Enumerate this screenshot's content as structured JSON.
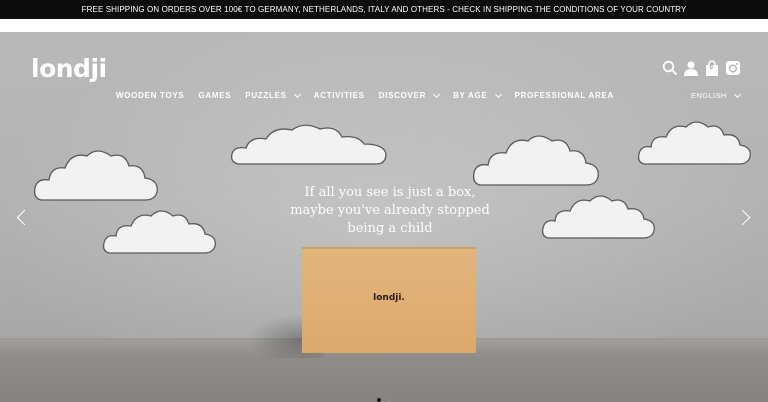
{
  "announcement": {
    "text": "FREE SHIPPING ON ORDERS OVER 100€ TO GERMANY, NETHERLANDS, ITALY AND OTHERS - CHECK IN SHIPPING THE CONDITIONS OF YOUR COUNTRY"
  },
  "header": {
    "logo": "londji",
    "nav": [
      {
        "label": "WOODEN TOYS",
        "dropdown": false
      },
      {
        "label": "GAMES",
        "dropdown": false
      },
      {
        "label": "PUZZLES",
        "dropdown": true
      },
      {
        "label": "ACTIVITIES",
        "dropdown": false
      },
      {
        "label": "DISCOVER",
        "dropdown": true
      },
      {
        "label": "BY AGE",
        "dropdown": true
      },
      {
        "label": "PROFESSIONAL AREA",
        "dropdown": false
      }
    ],
    "language": "ENGLISH",
    "icons": [
      "search-icon",
      "user-icon",
      "cart-icon",
      "instagram-icon"
    ],
    "cart_count": "0"
  },
  "hero": {
    "tagline_lines": [
      "If all you see is just a box,",
      "maybe you've already stopped",
      "being a child"
    ],
    "box_logo": "londji.",
    "box_sub": "",
    "slides_total": 2,
    "active_slide": 1
  },
  "colors": {
    "topbar": "#0d0d0d",
    "text_light": "#ffffff",
    "box": "#dcac70"
  }
}
